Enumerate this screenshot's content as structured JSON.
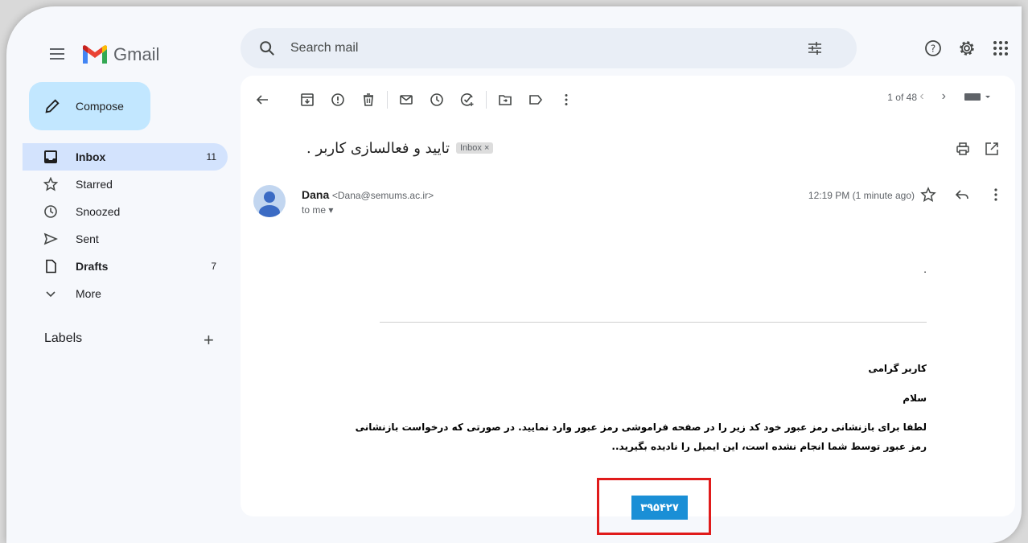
{
  "app": {
    "name": "Gmail"
  },
  "search": {
    "placeholder": "Search mail"
  },
  "sidebar": {
    "compose_label": "Compose",
    "items": [
      {
        "label": "Inbox",
        "count": "11",
        "icon": "inbox-icon"
      },
      {
        "label": "Starred",
        "count": "",
        "icon": "star-icon"
      },
      {
        "label": "Snoozed",
        "count": "",
        "icon": "clock-icon"
      },
      {
        "label": "Sent",
        "count": "",
        "icon": "send-icon"
      },
      {
        "label": "Drafts",
        "count": "7",
        "icon": "draft-icon"
      },
      {
        "label": "More",
        "count": "",
        "icon": "chevron-down-icon"
      }
    ],
    "labels_heading": "Labels",
    "labels_add": "+"
  },
  "toolbar": {
    "pager": "1 of 48"
  },
  "email": {
    "subject": "تایید و فعالسازی کاربر .",
    "tag": "Inbox ×",
    "sender_name": "Dana",
    "sender_address": "<Dana@semums.ac.ir>",
    "to": "to me ▾",
    "time": "12:19 PM (1 minute ago)",
    "dot": ".",
    "greeting": "کاربر گرامی",
    "salam": "سلام",
    "line1": "لطفا برای بازنشانی رمز عبور خود کد زیر را در صفحه فراموشی رمز عبور وارد نمایید. در صورتی که درخواست بازنشانی",
    "line2": "رمز عبور توسط شما انجام نشده است، این ایمیل را نادیده بگیرید..",
    "code": "۳۹۵۴۲۷"
  },
  "colors": {
    "compose_bg": "#c2e7ff",
    "active_bg": "#d3e3fd",
    "code_bg": "#1a8fd6",
    "highlight_border": "#e01b1b"
  }
}
